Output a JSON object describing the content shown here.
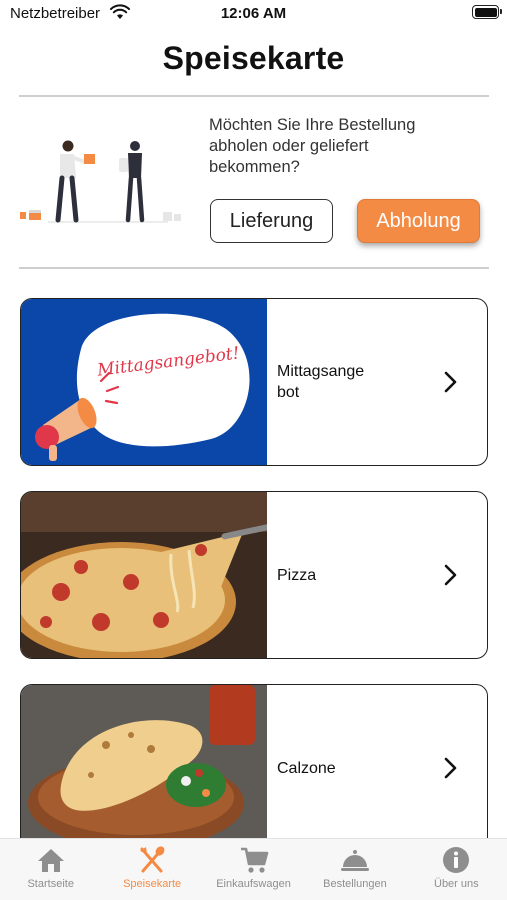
{
  "status_bar": {
    "carrier": "Netzbetreiber",
    "time": "12:06 AM"
  },
  "page": {
    "title": "Speisekarte"
  },
  "order_type": {
    "question_line1": "Möchten Sie Ihre Bestellung",
    "question_line2": "abholen oder geliefert",
    "question_line3": "bekommen?",
    "delivery_label": "Lieferung",
    "pickup_label": "Abholung",
    "selected": "Abholung"
  },
  "menu": {
    "items": [
      {
        "label_line1": "Mittagsange",
        "label_line2": "bot",
        "image_text": "Mittagsangebot!",
        "icon": "chevron-right-icon"
      },
      {
        "label_line1": "Pizza",
        "label_line2": "",
        "icon": "chevron-right-icon"
      },
      {
        "label_line1": "Calzone",
        "label_line2": "",
        "icon": "chevron-right-icon"
      }
    ]
  },
  "tab_bar": {
    "items": [
      {
        "label": "Startseite",
        "icon": "home-icon",
        "active": false
      },
      {
        "label": "Speisekarte",
        "icon": "fork-knife-icon",
        "active": true
      },
      {
        "label": "Einkaufswagen",
        "icon": "cart-icon",
        "active": false
      },
      {
        "label": "Bestellungen",
        "icon": "cloche-icon",
        "active": false
      },
      {
        "label": "Über uns",
        "icon": "info-icon",
        "active": false
      }
    ]
  },
  "colors": {
    "accent": "#f48b45",
    "banner_blue": "#0a47a8",
    "inactive_tab": "#8e8e8e"
  }
}
